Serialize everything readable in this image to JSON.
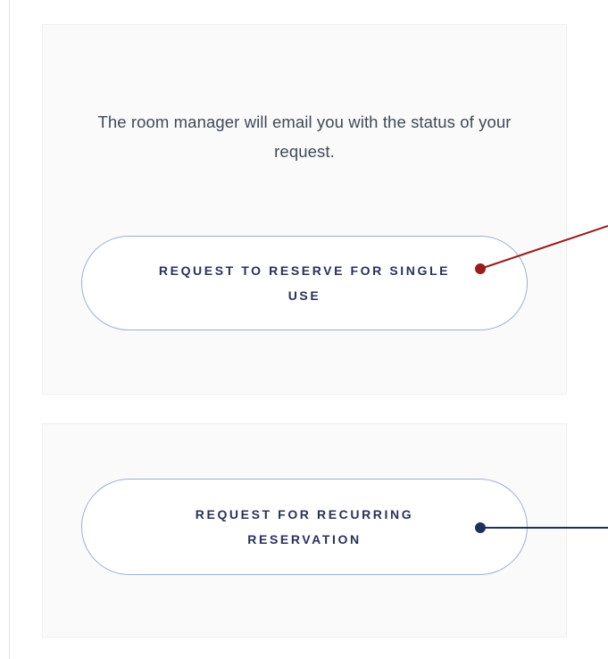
{
  "single_use_card": {
    "info_text": "The room manager will email you with the status of your request.",
    "button_label": "REQUEST TO RESERVE FOR SINGLE USE"
  },
  "recurring_card": {
    "button_label": "REQUEST FOR RECURRING RESERVATION"
  },
  "colors": {
    "button_text": "#28315c",
    "button_border": "#9bb0d0",
    "callout_single": "#9a1b1b",
    "callout_recurring": "#1e2f5c",
    "card_background": "#fafafa"
  }
}
